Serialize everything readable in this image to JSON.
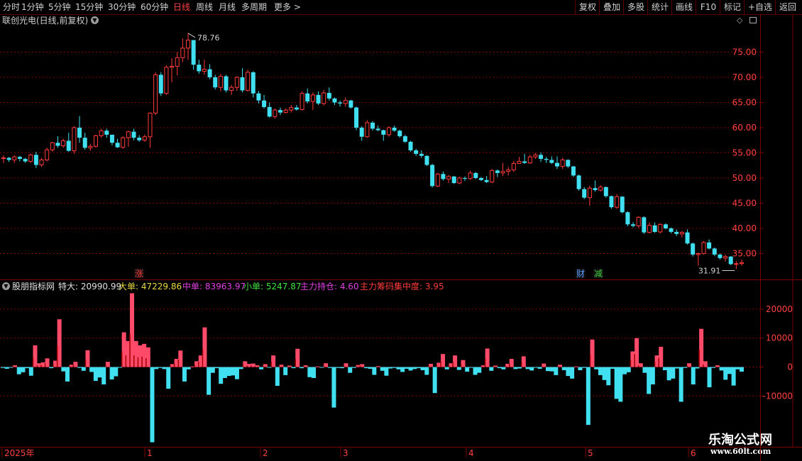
{
  "toolbar": {
    "periods": [
      {
        "label": "分时",
        "x": 4
      },
      {
        "label": "1分钟",
        "x": 30
      },
      {
        "label": "5分钟",
        "x": 68
      },
      {
        "label": "15分钟",
        "x": 106
      },
      {
        "label": "30分钟",
        "x": 152
      },
      {
        "label": "60分钟",
        "x": 198
      },
      {
        "label": "日线",
        "x": 244
      },
      {
        "label": "周线",
        "x": 276
      },
      {
        "label": "月线",
        "x": 308
      },
      {
        "label": "多周期",
        "x": 340
      },
      {
        "label": "更多",
        "x": 386
      }
    ],
    "more_arrow": ">",
    "right_buttons": [
      "复权",
      "叠加",
      "多股",
      "统计",
      "画线",
      "F10",
      "标记",
      "+自选",
      "返回"
    ]
  },
  "chart": {
    "stock_title": "联创光电(日线,前复权)",
    "price_ticks": [
      "75.00",
      "70.00",
      "65.00",
      "60.00",
      "55.00",
      "50.00",
      "45.00",
      "40.00",
      "35.00"
    ],
    "high_label": "78.76",
    "low_label": "31.91",
    "events": [
      {
        "label": "涨",
        "color": "#ff3b3b"
      },
      {
        "label": "财",
        "color": "#5a9cff"
      },
      {
        "label": "减",
        "color": "#40d040"
      }
    ]
  },
  "indicator": {
    "name": "股朋指标网",
    "items": [
      {
        "label": "特大: 20990.99",
        "color": "#e0e0e0"
      },
      {
        "label": "大单: 47229.86",
        "color": "#e8d840"
      },
      {
        "label": "中单: 83963.97",
        "color": "#e040e0"
      },
      {
        "label": "小单: 5247.87",
        "color": "#40e040"
      },
      {
        "label": "主力持仓: 4.60",
        "color": "#e040e0"
      },
      {
        "label": "主力筹码集中度: 3.95",
        "color": "#ff3b3b"
      }
    ],
    "ticks": [
      "20000",
      "10000",
      "0",
      "-10000"
    ]
  },
  "time_axis": [
    "2025年",
    "1",
    "2",
    "3",
    "4",
    "5",
    "6"
  ],
  "watermark": {
    "line1": "乐淘公式网",
    "line2": "www.60lt.com"
  },
  "colors": {
    "up": "#ff3b3b",
    "down": "#40e0f0",
    "grid": "#7a0000",
    "frame": "#7a0000"
  },
  "chart_data": [
    {
      "type": "candlestick",
      "title": "联创光电(日线,前复权)",
      "ylim": [
        31,
        80
      ],
      "max_price": 78.76,
      "min_price": 31.91,
      "bars": [
        [
          54,
          54.5,
          53,
          54
        ],
        [
          54,
          54.2,
          53.2,
          53.6
        ],
        [
          53.6,
          54.5,
          53,
          54.2
        ],
        [
          54.2,
          54.4,
          53.3,
          53.8
        ],
        [
          53.8,
          54,
          53,
          53.3
        ],
        [
          53.3,
          54.8,
          53,
          54.6
        ],
        [
          54.6,
          55.2,
          52,
          52.6
        ],
        [
          52.6,
          54,
          52.2,
          53.6
        ],
        [
          53.6,
          56,
          53.3,
          55.6
        ],
        [
          55.6,
          57.2,
          55.2,
          57
        ],
        [
          57,
          58.3,
          56,
          56.4
        ],
        [
          56.4,
          57.8,
          56,
          57.4
        ],
        [
          57.4,
          59,
          55.2,
          55.4
        ],
        [
          55.4,
          60.3,
          54.8,
          60
        ],
        [
          60,
          62.3,
          57,
          58
        ],
        [
          58,
          59,
          55.6,
          56
        ],
        [
          56,
          56.8,
          55.4,
          56.3
        ],
        [
          56.3,
          58.6,
          56,
          58.4
        ],
        [
          58.4,
          59.8,
          58,
          59.4
        ],
        [
          59.4,
          59.8,
          58,
          58.6
        ],
        [
          58.6,
          58.6,
          56.5,
          57
        ],
        [
          57,
          57.8,
          56,
          56.1
        ],
        [
          56.1,
          58.3,
          55.8,
          58
        ],
        [
          58,
          59.4,
          56.2,
          59.2
        ],
        [
          59.2,
          59.8,
          57.5,
          58
        ],
        [
          58,
          58.5,
          57.2,
          57.5
        ],
        [
          57.5,
          58.6,
          57.2,
          58.2
        ],
        [
          58.2,
          63,
          56,
          62.9
        ],
        [
          62.9,
          71,
          62.5,
          70.5
        ],
        [
          70.5,
          71,
          66.3,
          66.8
        ],
        [
          66.8,
          72.4,
          66.5,
          72
        ],
        [
          72,
          73.8,
          69,
          72.2
        ],
        [
          72.2,
          75,
          70.4,
          73.9
        ],
        [
          73.9,
          77.7,
          73,
          75.8
        ],
        [
          75.8,
          78.76,
          73.5,
          77.4
        ],
        [
          77.4,
          77.4,
          71.5,
          72.5
        ],
        [
          72.5,
          73.5,
          70.7,
          71.2
        ],
        [
          71.2,
          73.5,
          70.5,
          71.6
        ],
        [
          71.6,
          72.6,
          69.6,
          70
        ],
        [
          70,
          70.5,
          67.6,
          68
        ],
        [
          68,
          70.7,
          67.2,
          70.2
        ],
        [
          70.2,
          70.5,
          67,
          67.4
        ],
        [
          67.4,
          68.5,
          66.5,
          68
        ],
        [
          68,
          70.2,
          67.3,
          70
        ],
        [
          70,
          71.8,
          67,
          67.4
        ],
        [
          67.4,
          71.5,
          67.2,
          71
        ],
        [
          71,
          71.2,
          66,
          66.8
        ],
        [
          66.8,
          67.3,
          64.8,
          65.4
        ],
        [
          65.4,
          66.5,
          63.8,
          64.1
        ],
        [
          64.1,
          65,
          62,
          62.2
        ],
        [
          62.2,
          63.8,
          61.8,
          63.5
        ],
        [
          63.5,
          64,
          62.5,
          63
        ],
        [
          63,
          63.8,
          62.8,
          63.5
        ],
        [
          63.5,
          64.5,
          63,
          64
        ],
        [
          64,
          64.5,
          63.4,
          63.6
        ],
        [
          63.6,
          67.2,
          63.4,
          66.8
        ],
        [
          66.8,
          67.8,
          64.8,
          65.2
        ],
        [
          65.2,
          67,
          63.5,
          66.5
        ],
        [
          66.5,
          67.2,
          64.5,
          64.8
        ],
        [
          64.8,
          67.5,
          64.4,
          66.9
        ],
        [
          66.9,
          68,
          65.4,
          65.8
        ],
        [
          65.8,
          66,
          64.5,
          65
        ],
        [
          65,
          65.4,
          64.2,
          64.8
        ],
        [
          64.8,
          66,
          64.2,
          65.4
        ],
        [
          65.4,
          65.5,
          63.8,
          64
        ],
        [
          64,
          64.2,
          59.5,
          60
        ],
        [
          60,
          60.3,
          57.4,
          58.2
        ],
        [
          58.2,
          61.5,
          58,
          61
        ],
        [
          61,
          61.3,
          59.4,
          59.8
        ],
        [
          59.8,
          60.4,
          59.3,
          59.5
        ],
        [
          59.5,
          59.6,
          57.4,
          58.6
        ],
        [
          58.6,
          60.3,
          58.2,
          60
        ],
        [
          60,
          60.4,
          59.2,
          59.4
        ],
        [
          59.4,
          59.6,
          58,
          58.3
        ],
        [
          58.3,
          58.6,
          57,
          57.2
        ],
        [
          57.2,
          57.4,
          55.2,
          55.5
        ],
        [
          55.5,
          55.8,
          54.4,
          54.8
        ],
        [
          54.8,
          55.5,
          54,
          54.4
        ],
        [
          54.4,
          54.5,
          52.4,
          52.6
        ],
        [
          52.6,
          52.8,
          48.1,
          48.4
        ],
        [
          48.4,
          51,
          48.2,
          50.8
        ],
        [
          50.8,
          51.3,
          49.5,
          49.8
        ],
        [
          49.8,
          50.6,
          49,
          50.3
        ],
        [
          50.3,
          50.4,
          48.8,
          49
        ],
        [
          49,
          50.3,
          48.8,
          50
        ],
        [
          50,
          50.3,
          49.4,
          49.9
        ],
        [
          49.9,
          51.5,
          49.6,
          51
        ],
        [
          51,
          51.2,
          49.8,
          50
        ],
        [
          50,
          50.2,
          49.4,
          49.6
        ],
        [
          49.6,
          50.4,
          49,
          49.2
        ],
        [
          49.2,
          51.8,
          49,
          51.5
        ],
        [
          51.5,
          51.7,
          50.2,
          51
        ],
        [
          51,
          53,
          50.4,
          51.3
        ],
        [
          51.3,
          52.2,
          50.5,
          51.6
        ],
        [
          51.6,
          53.4,
          51.2,
          52.9
        ],
        [
          52.9,
          54.2,
          52.8,
          53.3
        ],
        [
          53.3,
          54.8,
          52.8,
          53
        ],
        [
          53,
          54.6,
          52.8,
          54.2
        ],
        [
          54.2,
          55,
          53.8,
          54.6
        ],
        [
          54.6,
          55.1,
          53.2,
          53.8
        ],
        [
          53.8,
          54.2,
          53,
          53.6
        ],
        [
          53.6,
          54.3,
          52.8,
          53
        ],
        [
          53,
          54.3,
          51.8,
          52.3
        ],
        [
          52.3,
          54,
          51.8,
          53.6
        ],
        [
          53.6,
          53.7,
          52,
          52.3
        ],
        [
          52.3,
          52.4,
          50.2,
          50.5
        ],
        [
          50.5,
          50.7,
          47.5,
          47.8
        ],
        [
          47.8,
          48.2,
          45.8,
          46.1
        ],
        [
          46.1,
          48.5,
          44.5,
          48
        ],
        [
          48,
          49.5,
          47.3,
          47.6
        ],
        [
          47.6,
          48.6,
          47.3,
          48.2
        ],
        [
          48.2,
          48.3,
          46.1,
          46.4
        ],
        [
          46.4,
          46.5,
          43.9,
          44.2
        ],
        [
          44.2,
          46.8,
          43.9,
          46.3
        ],
        [
          46.3,
          46.4,
          43,
          43.2
        ],
        [
          43.2,
          43.4,
          40.4,
          40.8
        ],
        [
          40.8,
          41.2,
          40.2,
          40.5
        ],
        [
          40.5,
          42.4,
          40.1,
          42.2
        ],
        [
          42.2,
          42.4,
          38.9,
          39.2
        ],
        [
          39.2,
          41.2,
          39,
          40.6
        ],
        [
          40.6,
          41.2,
          39.1,
          39.3
        ],
        [
          39.3,
          41,
          39,
          40.8
        ],
        [
          40.8,
          41,
          39.8,
          40
        ],
        [
          40,
          40.2,
          39,
          39.3
        ],
        [
          39.3,
          39.8,
          38.5,
          38.9
        ],
        [
          38.9,
          39.5,
          38.2,
          39.2
        ],
        [
          39.2,
          39.8,
          36.8,
          37
        ],
        [
          37,
          37.2,
          34.4,
          34.8
        ],
        [
          34.8,
          35.2,
          32.6,
          35
        ],
        [
          35,
          37.5,
          34.8,
          37.2
        ],
        [
          37.2,
          37.8,
          35.8,
          36
        ],
        [
          36,
          36.2,
          34.5,
          34.8
        ],
        [
          34.8,
          35,
          33.8,
          34.1
        ],
        [
          34.1,
          34.8,
          33.4,
          34.4
        ],
        [
          34.4,
          34.5,
          32.7,
          32.9
        ],
        [
          32.9,
          33.5,
          31.91,
          33
        ],
        [
          33,
          33.8,
          32.6,
          33.2
        ]
      ]
    },
    {
      "type": "bar",
      "title": "股朋指标网",
      "ylim": [
        -13500,
        27500
      ],
      "values": [
        -300,
        -600,
        -200,
        600,
        -2500,
        -1800,
        -400,
        -3000,
        7500,
        1300,
        1600,
        3000,
        -400,
        2200,
        16500,
        -1500,
        -5000,
        800,
        1800,
        -300,
        -1300,
        5800,
        -1700,
        -4800,
        -3600,
        -6000,
        1800,
        -4300,
        -3200,
        -200,
        12000,
        9000,
        25500,
        9000,
        7500,
        8000,
        6800,
        -26000,
        -700,
        -300,
        -700,
        -7500,
        1000,
        2800,
        5700,
        -5000,
        -800,
        200,
        2000,
        4000,
        13700,
        -9600,
        -2000,
        -400,
        -5800,
        -3800,
        -3100,
        -2900,
        -4200,
        -700,
        2000,
        1100,
        1200,
        600,
        -800,
        1000,
        -200,
        4000,
        -6500,
        800,
        -2800,
        500,
        -400,
        6300,
        -400,
        600,
        -3500,
        -3800,
        200,
        -200,
        1300,
        -300,
        -14000,
        -300,
        -400,
        1300,
        -2000,
        -300,
        700,
        1000,
        -400,
        -600,
        -2700,
        300,
        -1300,
        -3000,
        -500,
        -300,
        -800,
        -1700,
        -600,
        -1200,
        -700,
        -400,
        -1100,
        -2700,
        1100,
        -9000,
        1500,
        4500,
        -800,
        1300,
        4000,
        -1000,
        2400,
        -1600,
        -200,
        -2700,
        -2000,
        600,
        6400,
        -1300,
        500,
        -400,
        -800,
        1100,
        2800,
        -700,
        -500,
        3700,
        -700,
        -1200,
        -200,
        -600,
        1200,
        -1400,
        -1500,
        -2800,
        800,
        -1100,
        -3100,
        -4000,
        200,
        -1100,
        -300,
        -20000,
        9500,
        -800,
        -2800,
        -4500,
        -6300,
        -600,
        -11000,
        -12000,
        -2500,
        -1800,
        5400,
        10000,
        1300,
        -2000,
        -9300,
        -6000,
        4000,
        7000,
        -1100,
        -4600,
        -4000,
        -500,
        -12000,
        -300,
        1300,
        -6000,
        -500,
        13200,
        2000,
        -7000,
        -300,
        600,
        -1200,
        -4400,
        -2400,
        -6400,
        -800,
        -1600
      ]
    }
  ]
}
